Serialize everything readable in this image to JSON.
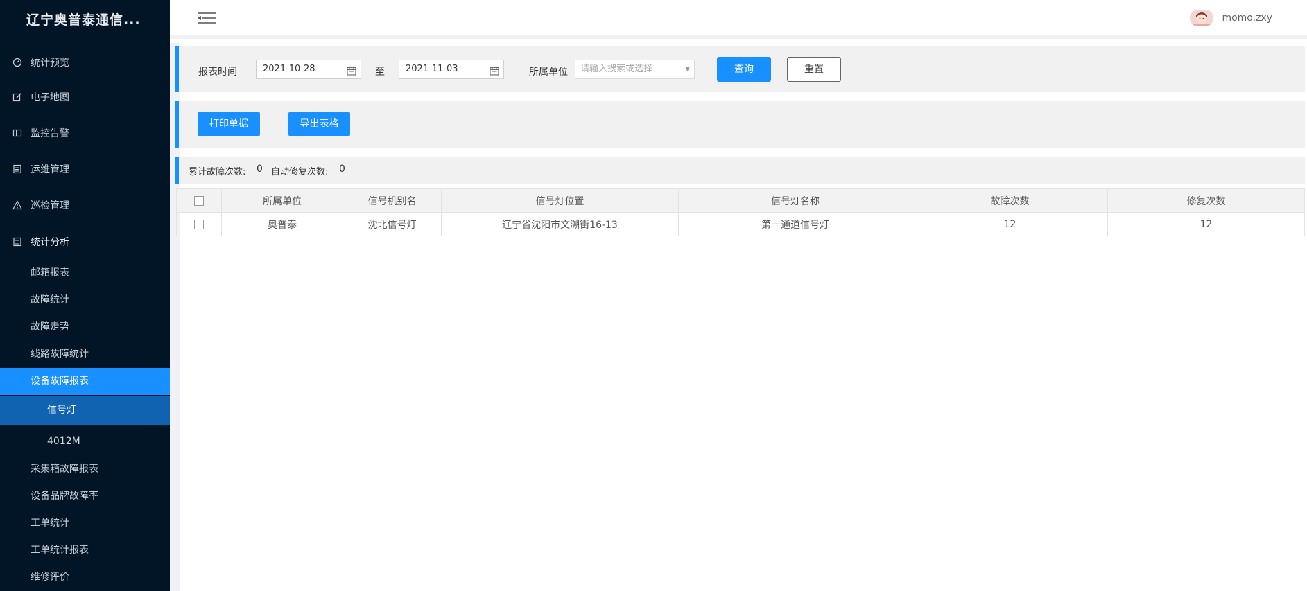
{
  "sidebar": {
    "brand": "辽宁奥普泰通信...",
    "menu": [
      {
        "label": "统计预览",
        "icon": "dashboard-icon"
      },
      {
        "label": "电子地图",
        "icon": "edit-icon"
      },
      {
        "label": "监控告警",
        "icon": "table-icon"
      },
      {
        "label": "运维管理",
        "icon": "list-icon"
      },
      {
        "label": "巡检管理",
        "icon": "warning-icon"
      },
      {
        "label": "统计分析",
        "icon": "list-icon"
      }
    ],
    "submenu": [
      {
        "label": "邮箱报表"
      },
      {
        "label": "故障统计"
      },
      {
        "label": "故障走势"
      },
      {
        "label": "线路故障统计"
      },
      {
        "label": "设备故障报表"
      }
    ],
    "subsubmenu": [
      {
        "label": "信号灯"
      },
      {
        "label": "4012M"
      }
    ],
    "submenu2": [
      {
        "label": "采集箱故障报表"
      },
      {
        "label": "设备品牌故障率"
      },
      {
        "label": "工单统计"
      },
      {
        "label": "工单统计报表"
      },
      {
        "label": "维修评价"
      }
    ]
  },
  "header": {
    "username": "momo.zxy"
  },
  "filter": {
    "time_label": "报表时间",
    "start_date": "2021-10-28",
    "to_label": "至",
    "end_date": "2021-11-03",
    "unit_label": "所属单位",
    "unit_placeholder": "请输入搜索或选择",
    "query_button": "查询",
    "reset_button": "重置"
  },
  "actions": {
    "print_button": "打印单据",
    "export_button": "导出表格"
  },
  "stats": {
    "fault_total_label": "累计故障次数:",
    "fault_total_value": "0",
    "auto_repair_label": "自动修复次数:",
    "auto_repair_value": "0"
  },
  "table": {
    "headers": [
      "所属单位",
      "信号机别名",
      "信号灯位置",
      "信号灯名称",
      "故障次数",
      "修复次数"
    ],
    "rows": [
      [
        "奥普泰",
        "沈北信号灯",
        "辽宁省沈阳市文溯街16-13",
        "第一通道信号灯",
        "12",
        "12"
      ]
    ]
  },
  "colors": {
    "sidebar_bg": "#021526",
    "accent": "#1890ff",
    "active_sub": "#0f63b0"
  }
}
